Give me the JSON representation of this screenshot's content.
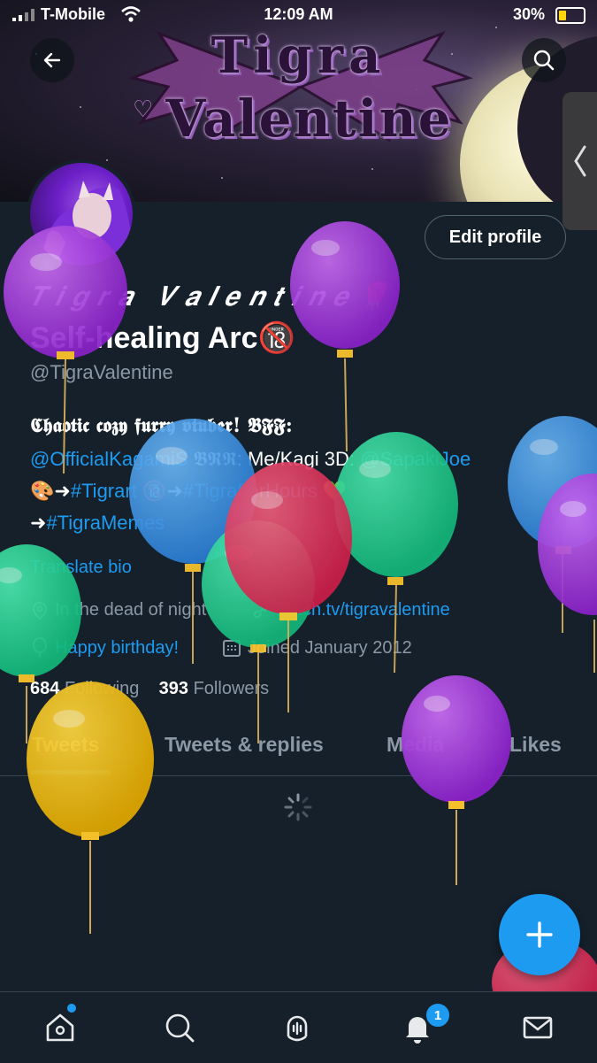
{
  "status_bar": {
    "carrier": "T-Mobile",
    "time": "12:09 AM",
    "battery": "30%"
  },
  "banner": {
    "title_line1": "Tigra",
    "title_line2": "Valentine"
  },
  "profile": {
    "edit_label": "Edit profile",
    "display_name_line1": "𝑻𝒊𝒈𝒓𝒂 𝑽𝒂𝒍𝒆𝒏𝒕𝒊𝒏𝒆🌹",
    "display_name_line2": "Self-healing Arc🔞",
    "handle": "@TigraValentine",
    "bio": {
      "line1": "𝕮𝖍𝖆𝖔𝖙𝖎𝖈 𝖈𝖔𝖟𝖞 𝖋𝖚𝖗𝖗𝖞 𝖛𝖙𝖚𝖇𝖊𝖗! 𝕭𝕱𝕱:",
      "line2_link1": "@OfficialKagamiS",
      "line2_text": " 𝕭𝕽𝕽: Me/Kagi 3D: ",
      "line2_link2": "@SapakiJoe",
      "line3_prefix": "🎨➜",
      "line3_link1": "#Tigrart",
      "line3_mid": " 🔞➜",
      "line3_link2": "#TigrafterHours",
      "line3_suffix": " 💚",
      "line4_prefix": "➜",
      "line4_link": "#TigraMemes"
    },
    "translate": "Translate bio",
    "location": "In the dead of night",
    "url": "twitch.tv/tigravalentine",
    "birthday": "Happy birthday!",
    "joined": "Joined January 2012",
    "following_count": "684",
    "following_label": "Following",
    "followers_count": "393",
    "followers_label": "Followers"
  },
  "tabs": [
    "Tweets",
    "Tweets & replies",
    "Media",
    "Likes"
  ],
  "nav": {
    "notifications_badge": "1"
  },
  "icons": [
    "back-arrow-icon",
    "search-icon",
    "chevron-left-icon",
    "location-icon",
    "link-icon",
    "balloon-icon",
    "calendar-icon",
    "home-icon",
    "spaces-icon",
    "bell-icon",
    "mail-icon",
    "plus-icon"
  ],
  "colors": {
    "accent": "#1d9bf0",
    "background": "#15202b",
    "muted": "#8b98a5"
  }
}
